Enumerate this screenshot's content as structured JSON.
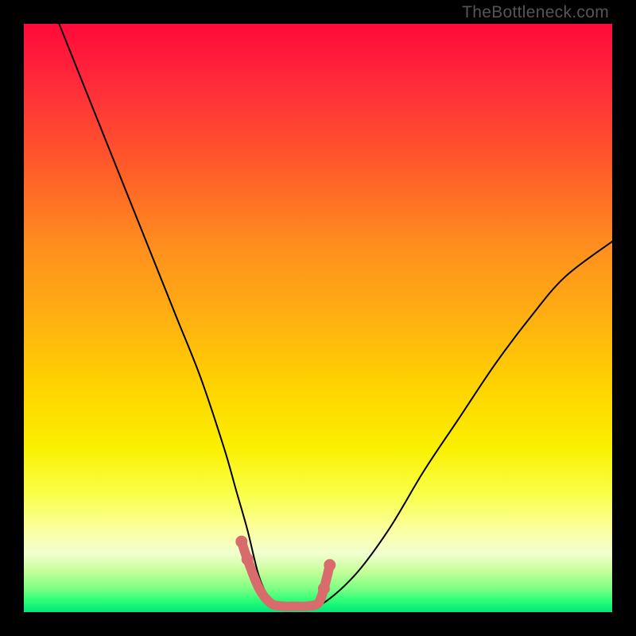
{
  "watermark": {
    "text": "TheBottleneck.com"
  },
  "frame": {
    "border_color": "#000000",
    "background": "gradient"
  },
  "chart_data": {
    "type": "line",
    "title": "",
    "xlabel": "",
    "ylabel": "",
    "xlim": [
      0,
      100
    ],
    "ylim": [
      0,
      100
    ],
    "series": [
      {
        "name": "bottleneck-curve",
        "color": "#000000",
        "x": [
          6,
          10,
          14,
          18,
          22,
          26,
          30,
          34,
          36,
          38,
          40,
          42,
          44,
          46,
          50,
          56,
          62,
          68,
          74,
          80,
          86,
          92,
          100
        ],
        "y": [
          100,
          90,
          80,
          70,
          60,
          50,
          40,
          28,
          21,
          14,
          6,
          2,
          1,
          1,
          1,
          6,
          14,
          24,
          33,
          42,
          50,
          57,
          63
        ]
      },
      {
        "name": "highlight-segment",
        "color": "#d86b6b",
        "x": [
          37,
          38,
          40,
          42,
          44,
          46,
          48,
          50,
          51,
          52
        ],
        "y": [
          12,
          9,
          4,
          1.5,
          1,
          1,
          1,
          1.5,
          4,
          8
        ]
      }
    ],
    "annotations": []
  }
}
